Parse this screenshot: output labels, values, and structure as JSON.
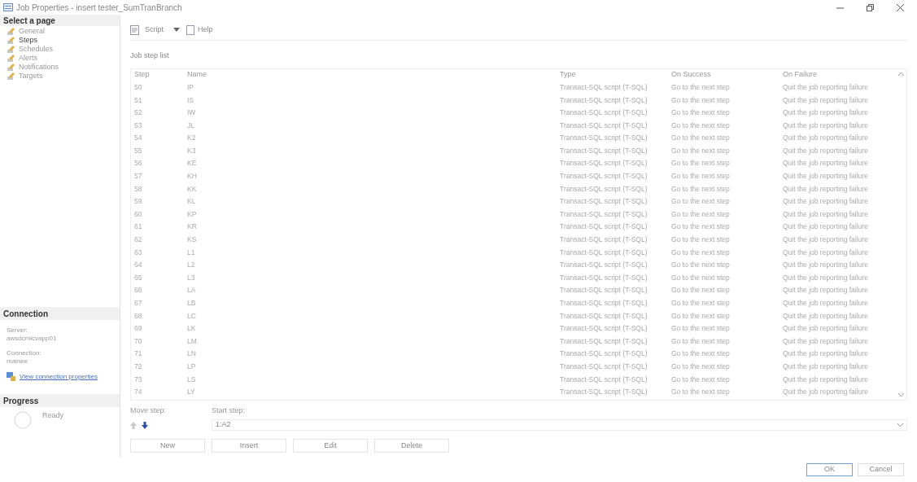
{
  "window": {
    "title": "Job Properties - insert tester_SumTranBranch"
  },
  "sidebar": {
    "heading": "Select a page",
    "items": [
      {
        "label": "General",
        "selected": false
      },
      {
        "label": "Steps",
        "selected": true
      },
      {
        "label": "Schedules",
        "selected": false
      },
      {
        "label": "Alerts",
        "selected": false
      },
      {
        "label": "Notifications",
        "selected": false
      },
      {
        "label": "Targets",
        "selected": false
      }
    ]
  },
  "connection": {
    "heading": "Connection",
    "server_label": "Server:",
    "server": "awsdcmicvapp01",
    "connection_label": "Connection:",
    "connection": "mainee",
    "link": "View connection properties"
  },
  "progress": {
    "heading": "Progress",
    "status": "Ready"
  },
  "toolbar": {
    "script": "Script",
    "help": "Help"
  },
  "table": {
    "caption": "Job step list",
    "columns": [
      "Step",
      "Name",
      "Type",
      "On Success",
      "On Failure"
    ],
    "rows": [
      [
        "50",
        "IP",
        "Transact-SQL script (T-SQL)",
        "Go to the next step",
        "Quit the job reporting failure"
      ],
      [
        "51",
        "IS",
        "Transact-SQL script (T-SQL)",
        "Go to the next step",
        "Quit the job reporting failure"
      ],
      [
        "52",
        "IW",
        "Transact-SQL script (T-SQL)",
        "Go to the next step",
        "Quit the job reporting failure"
      ],
      [
        "53",
        "JL",
        "Transact-SQL script (T-SQL)",
        "Go to the next step",
        "Quit the job reporting failure"
      ],
      [
        "54",
        "K2",
        "Transact-SQL script (T-SQL)",
        "Go to the next step",
        "Quit the job reporting failure"
      ],
      [
        "55",
        "K3",
        "Transact-SQL script (T-SQL)",
        "Go to the next step",
        "Quit the job reporting failure"
      ],
      [
        "56",
        "KE",
        "Transact-SQL script (T-SQL)",
        "Go to the next step",
        "Quit the job reporting failure"
      ],
      [
        "57",
        "KH",
        "Transact-SQL script (T-SQL)",
        "Go to the next step",
        "Quit the job reporting failure"
      ],
      [
        "58",
        "KK",
        "Transact-SQL script (T-SQL)",
        "Go to the next step",
        "Quit the job reporting failure"
      ],
      [
        "59",
        "KL",
        "Transact-SQL script (T-SQL)",
        "Go to the next step",
        "Quit the job reporting failure"
      ],
      [
        "60",
        "KP",
        "Transact-SQL script (T-SQL)",
        "Go to the next step",
        "Quit the job reporting failure"
      ],
      [
        "61",
        "KR",
        "Transact-SQL script (T-SQL)",
        "Go to the next step",
        "Quit the job reporting failure"
      ],
      [
        "62",
        "KS",
        "Transact-SQL script (T-SQL)",
        "Go to the next step",
        "Quit the job reporting failure"
      ],
      [
        "63",
        "L1",
        "Transact-SQL script (T-SQL)",
        "Go to the next step",
        "Quit the job reporting failure"
      ],
      [
        "64",
        "L2",
        "Transact-SQL script (T-SQL)",
        "Go to the next step",
        "Quit the job reporting failure"
      ],
      [
        "65",
        "L3",
        "Transact-SQL script (T-SQL)",
        "Go to the next step",
        "Quit the job reporting failure"
      ],
      [
        "66",
        "LA",
        "Transact-SQL script (T-SQL)",
        "Go to the next step",
        "Quit the job reporting failure"
      ],
      [
        "67",
        "LB",
        "Transact-SQL script (T-SQL)",
        "Go to the next step",
        "Quit the job reporting failure"
      ],
      [
        "68",
        "LC",
        "Transact-SQL script (T-SQL)",
        "Go to the next step",
        "Quit the job reporting failure"
      ],
      [
        "69",
        "LK",
        "Transact-SQL script (T-SQL)",
        "Go to the next step",
        "Quit the job reporting failure"
      ],
      [
        "70",
        "LM",
        "Transact-SQL script (T-SQL)",
        "Go to the next step",
        "Quit the job reporting failure"
      ],
      [
        "71",
        "LN",
        "Transact-SQL script (T-SQL)",
        "Go to the next step",
        "Quit the job reporting failure"
      ],
      [
        "72",
        "LP",
        "Transact-SQL script (T-SQL)",
        "Go to the next step",
        "Quit the job reporting failure"
      ],
      [
        "73",
        "LS",
        "Transact-SQL script (T-SQL)",
        "Go to the next step",
        "Quit the job reporting failure"
      ],
      [
        "74",
        "LY",
        "Transact-SQL script (T-SQL)",
        "Go to the next step",
        "Quit the job reporting failure"
      ]
    ]
  },
  "move_step": {
    "label": "Move step:",
    "up_disabled": true,
    "down_disabled": false
  },
  "start_step": {
    "label": "Start step:",
    "value": "1:A2"
  },
  "actions": [
    "New",
    "Insert",
    "Edit",
    "Delete"
  ],
  "buttons": [
    "OK",
    "Cancel"
  ]
}
